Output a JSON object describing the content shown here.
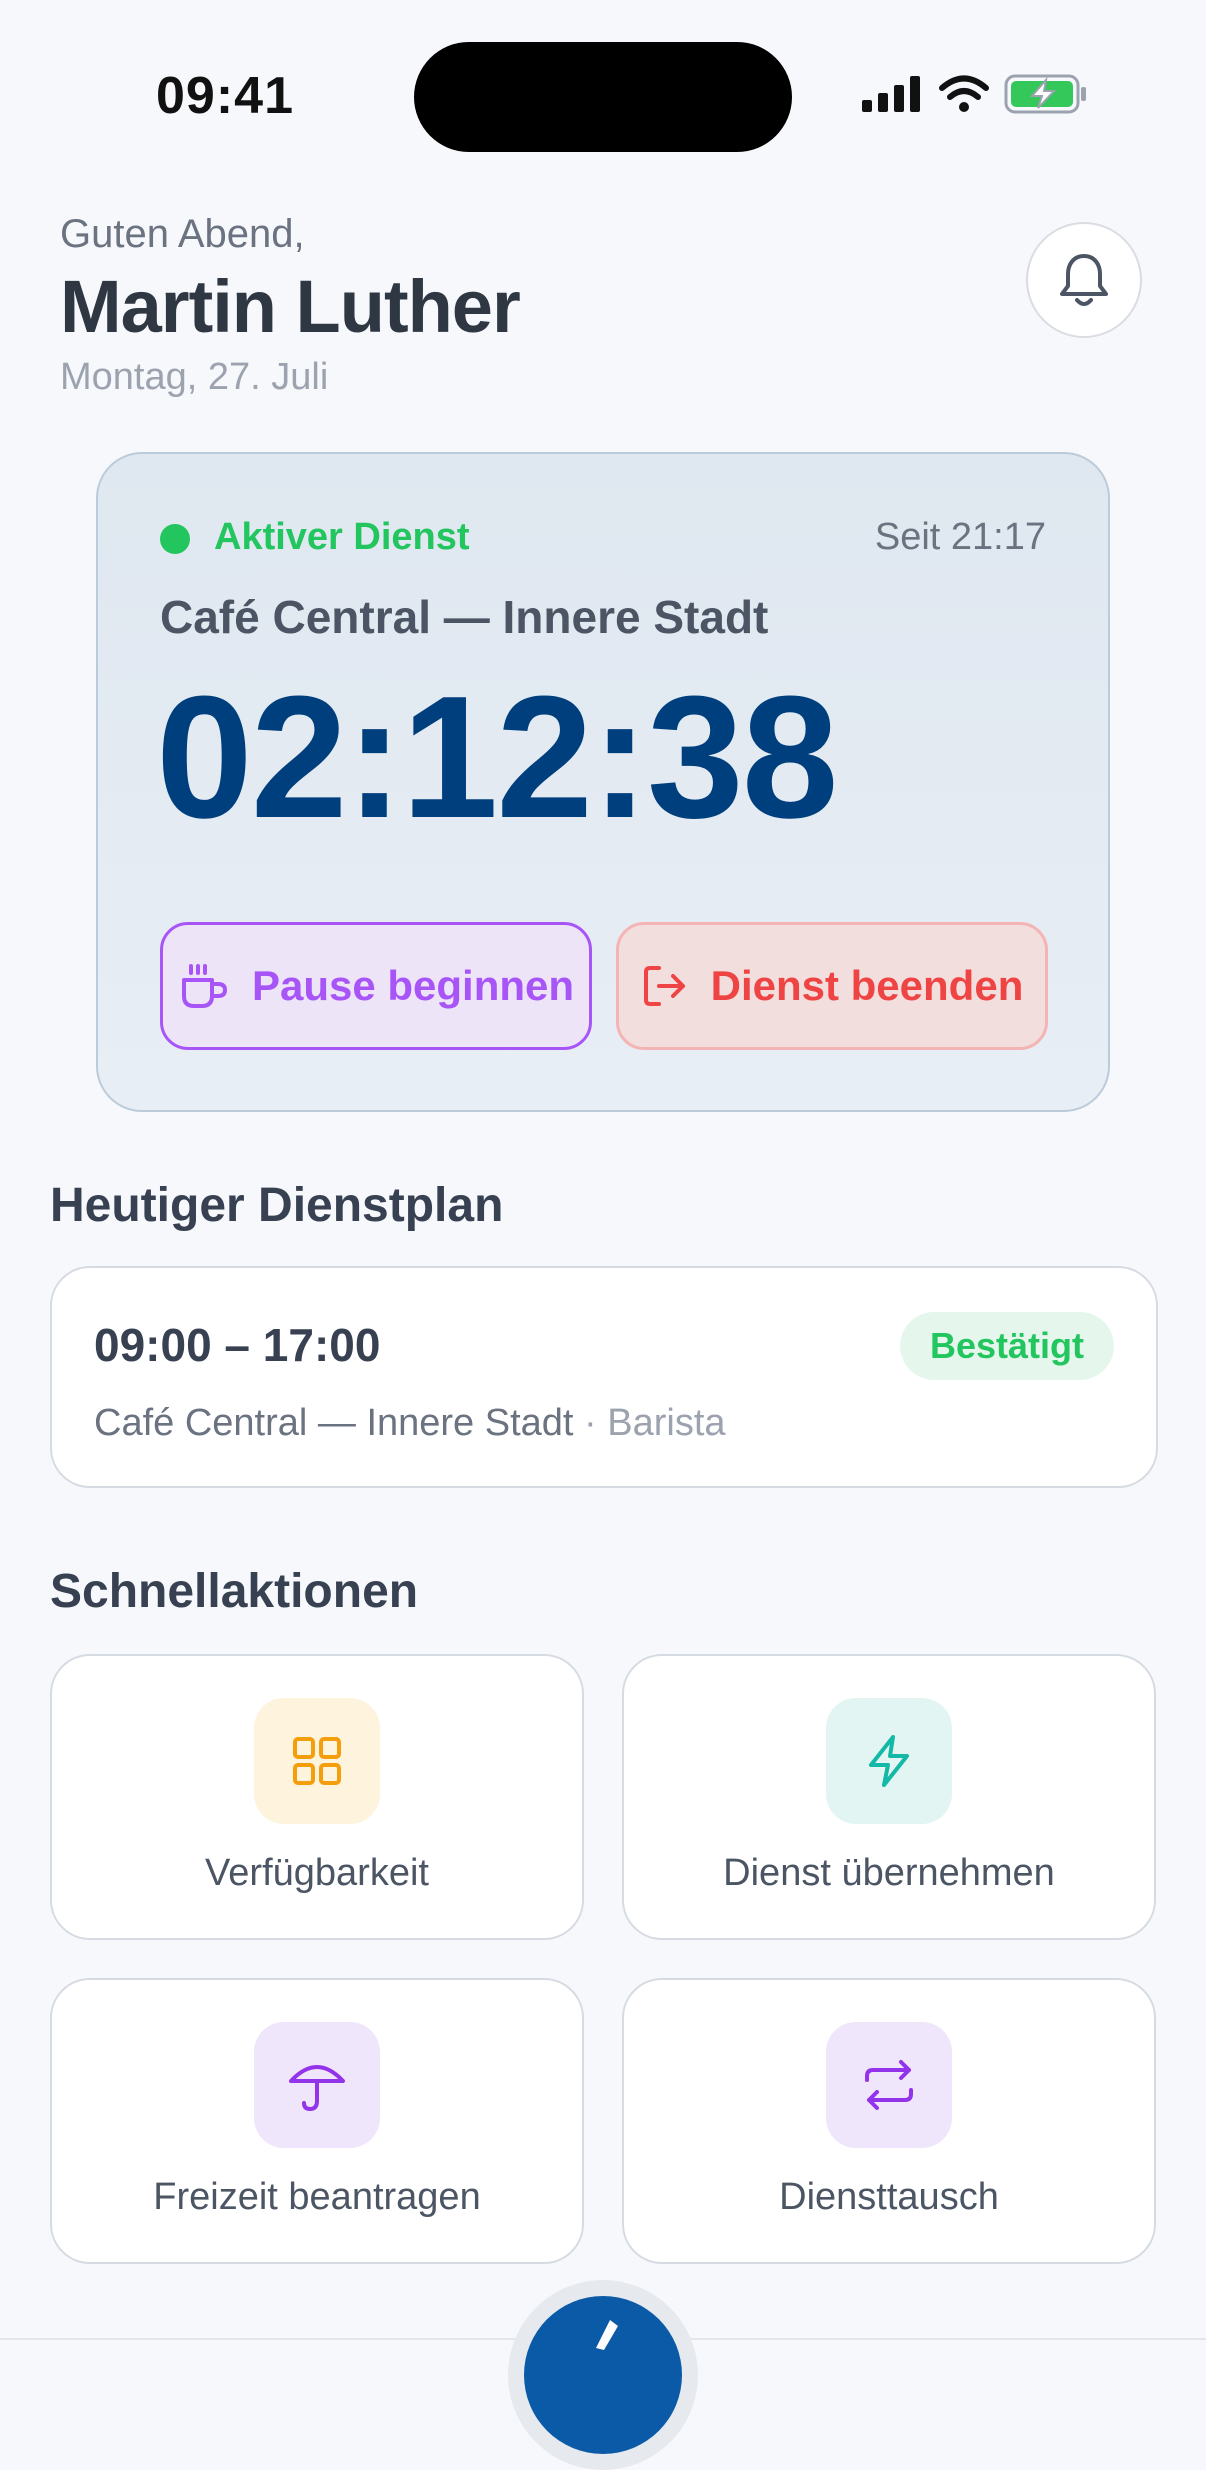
{
  "status_bar": {
    "time": "09:41"
  },
  "header": {
    "greeting": "Guten Abend,",
    "name": "Martin Luther",
    "date": "Montag, 27. Juli"
  },
  "active_shift": {
    "status": "Aktiver Dienst",
    "since": "Seit 21:17",
    "location": "Café Central — Innere Stadt",
    "timer": "02:12:38",
    "pause_label": "Pause beginnen",
    "end_label": "Dienst beenden"
  },
  "schedule": {
    "title": "Heutiger Dienstplan",
    "time": "09:00 – 17:00",
    "location": "Café Central — Innere Stadt",
    "role": "· Barista",
    "badge": "Bestätigt"
  },
  "quick_actions": {
    "title": "Schnellaktionen",
    "items": [
      {
        "label": "Verfügbarkeit",
        "icon": "grid-icon",
        "bg": "#fef3dc",
        "color": "#f59e0b"
      },
      {
        "label": "Dienst übernehmen",
        "icon": "lightning-icon",
        "bg": "#e3f5f2",
        "color": "#14b8a6"
      },
      {
        "label": "Freizeit beantragen",
        "icon": "umbrella-icon",
        "bg": "#efe6fb",
        "color": "#9333ea"
      },
      {
        "label": "Diensttausch",
        "icon": "swap-icon",
        "bg": "#efe6fb",
        "color": "#9333ea"
      }
    ]
  },
  "colors": {
    "accent": "#003f7d",
    "success": "#22c55e",
    "danger": "#ef4444",
    "purple": "#a855f7"
  }
}
